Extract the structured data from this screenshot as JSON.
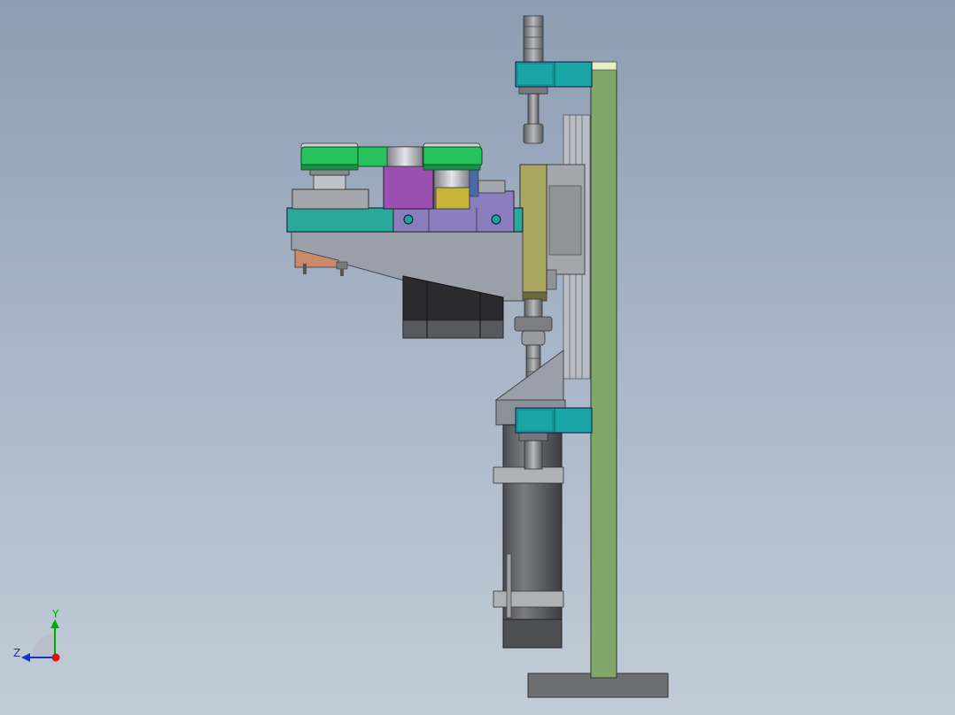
{
  "colors": {
    "background_top": "#8d9db3",
    "background_bottom": "#c2ccd8",
    "upright_plate": "#7fa76a",
    "upright_cap": "#e6f0c4",
    "base_plate": "#6d6e72",
    "clamp_blocks": "#1aa6a6",
    "mounting_plate": "#2aa89a",
    "pulleys_belt": "#27c25a",
    "slider_block": "#a9a762",
    "purple_block": "#9b4fb0",
    "lavender_block": "#8a7ec0",
    "gold_bushing": "#c7b23a",
    "motor_body": "#2b2b2e",
    "cylinder_body": "#5e5f63",
    "bracket": "#9aa0aa",
    "copper_part": "#c98a6b"
  },
  "triad": {
    "y_label": "Y",
    "z_label": "Z",
    "y_color": "#00aa00",
    "z_color": "#1a33cc",
    "x_color": "#dd1111"
  }
}
